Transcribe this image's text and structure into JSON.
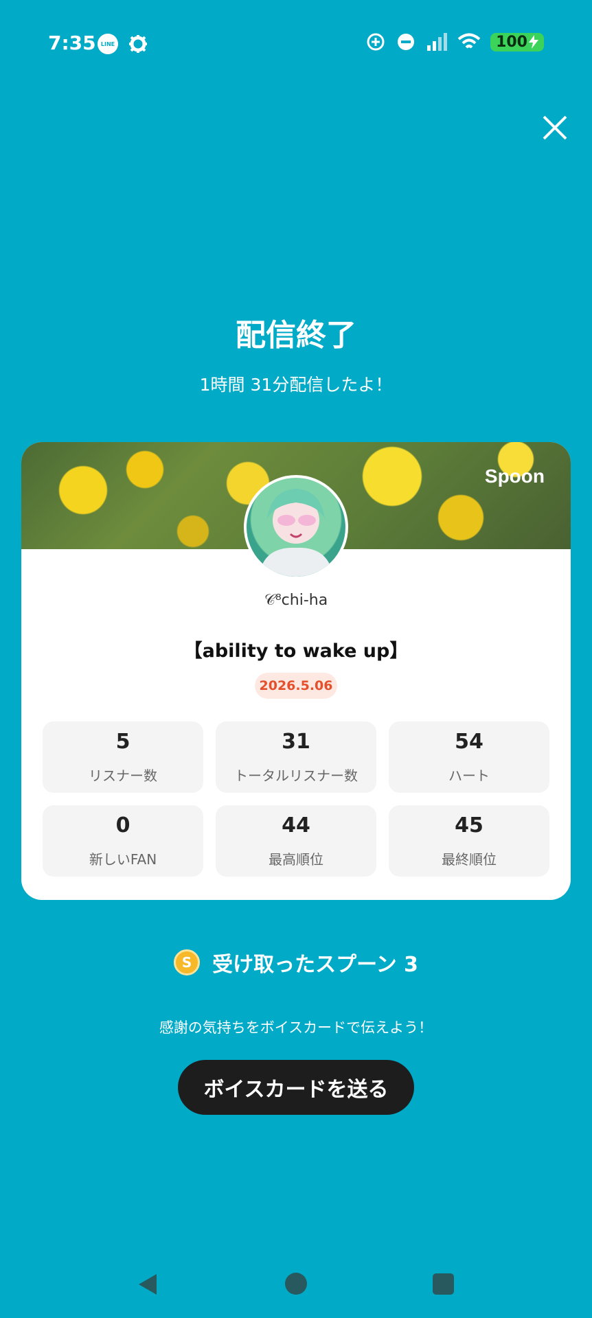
{
  "status_bar": {
    "time": "7:35",
    "line_label": "LINE",
    "battery": "100"
  },
  "header": {
    "title": "配信終了",
    "subtitle": "1時間 31分配信したよ！"
  },
  "card": {
    "brand": "Spoon",
    "username": "𝒞⁸chi-ha",
    "show_title": "【ability to wake up】",
    "date": "2026.5.06",
    "stats": [
      {
        "value": "5",
        "label": "リスナー数"
      },
      {
        "value": "31",
        "label": "トータルリスナー数"
      },
      {
        "value": "54",
        "label": "ハート"
      },
      {
        "value": "0",
        "label": "新しいFAN"
      },
      {
        "value": "44",
        "label": "最高順位"
      },
      {
        "value": "45",
        "label": "最終順位"
      }
    ]
  },
  "spoons": {
    "coin_label": "S",
    "text": "受け取ったスプーン  3"
  },
  "thanks_text": "感謝の気持ちをボイスカードで伝えよう！",
  "voice_card_button": "ボイスカードを送る",
  "icons": {
    "close": "close-icon",
    "settings": "gear-icon",
    "wifi": "wifi-icon",
    "signal": "signal-icon"
  },
  "colors": {
    "background": "#01aac6",
    "button": "#1d1d1d",
    "date_text": "#e4502b"
  }
}
